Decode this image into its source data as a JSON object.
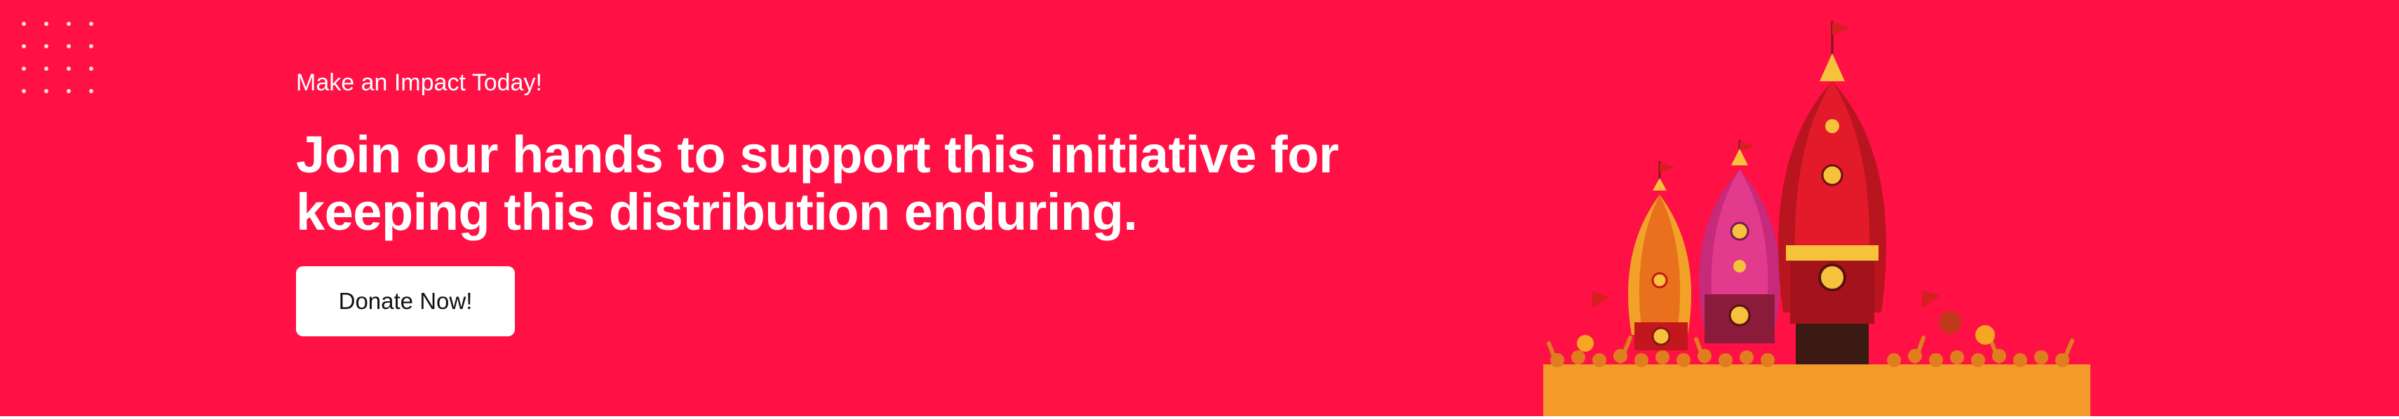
{
  "banner": {
    "eyebrow": "Make an Impact Today!",
    "headline_line1": "Join our hands to support this initiative for",
    "headline_line2": "keeping this distribution enduring.",
    "cta_label": "Donate Now!",
    "background_color": "#ff1045"
  },
  "illustration": {
    "subject": "rath-yatra-chariots-icon"
  }
}
